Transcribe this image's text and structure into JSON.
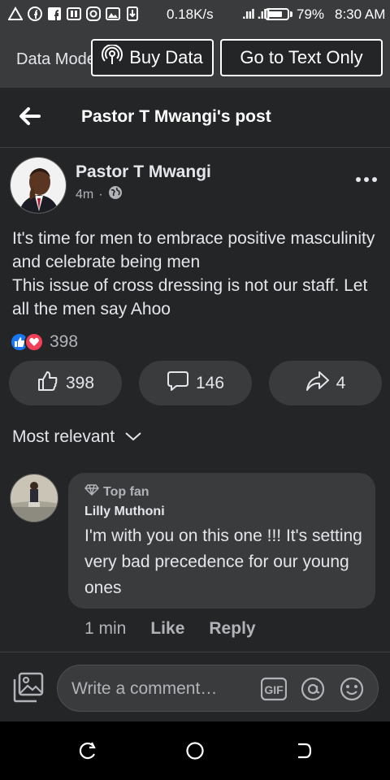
{
  "status_bar": {
    "speed": "0.18K/s",
    "signal": ".ııl .ıll",
    "battery_text": "79%",
    "battery_level_percent": 79,
    "time": "8:30 AM",
    "icons": [
      "alert-icon",
      "facebook-circle-icon",
      "facebook-icon",
      "photo-icon",
      "instagram-icon",
      "gallery-icon",
      "download-icon"
    ]
  },
  "data_bar": {
    "mode_text": "Data Mode",
    "buy_data_label": "Buy Data",
    "text_only_label": "Go to Text Only"
  },
  "header": {
    "title": "Pastor T Mwangi's post"
  },
  "post": {
    "author": "Pastor T Mwangi",
    "time": "4m",
    "separator": "·",
    "text": "It's time for men to embrace positive masculinity and celebrate being men\n This issue of cross dressing is not our staff. Let all the men say Ahoo",
    "reaction_count": "398",
    "like_count": "398",
    "comment_count": "146",
    "share_count": "4"
  },
  "comments": {
    "sort_label": "Most relevant",
    "items": [
      {
        "badge": "Top fan",
        "name": "Lilly Muthoni",
        "text": "I'm with you on this one !!! It's setting very bad precedence for our young ones",
        "time": "1 min",
        "like_label": "Like",
        "reply_label": "Reply"
      }
    ]
  },
  "composer": {
    "placeholder": "Write a comment…",
    "gif_label": "GIF"
  },
  "colors": {
    "background": "#242526",
    "surface": "#3a3b3c",
    "text_primary": "#e4e6eb",
    "text_secondary": "#b0b3b8",
    "like_blue": "#1877f2",
    "love_red": "#f33e58"
  }
}
